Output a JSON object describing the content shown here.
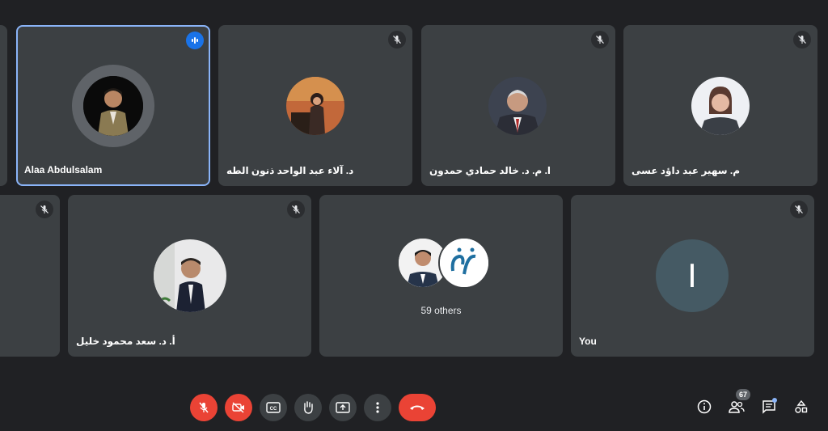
{
  "participants": {
    "row1": [
      {
        "name": "Alaa Abdulsalam",
        "speaking": true
      },
      {
        "name": "د. آلاء عبد الواحد ذنون الطه",
        "muted": true
      },
      {
        "name": "ا. م. د. خالد حمادي حمدون",
        "muted": true
      },
      {
        "name": "م. سهير عبد داؤد عسى",
        "muted": true
      }
    ],
    "row2": [
      {
        "name": "",
        "muted": true
      },
      {
        "name": "أ. د. سعد محمود خليل",
        "muted": true
      },
      {
        "name": "",
        "others_label": "59 others"
      },
      {
        "name": "You",
        "initial": "I",
        "muted": true
      }
    ]
  },
  "controls": {
    "mic": "microphone-off",
    "camera": "camera-off",
    "captions": "CC",
    "hand": "raise-hand",
    "present": "present-screen",
    "more": "more-options",
    "end": "end-call"
  },
  "right_controls": {
    "people_count": "67"
  },
  "colors": {
    "background": "#202124",
    "tile": "#3c4043",
    "active_border": "#8ab4f8",
    "red": "#ea4335",
    "speaking": "#1a73e8"
  }
}
